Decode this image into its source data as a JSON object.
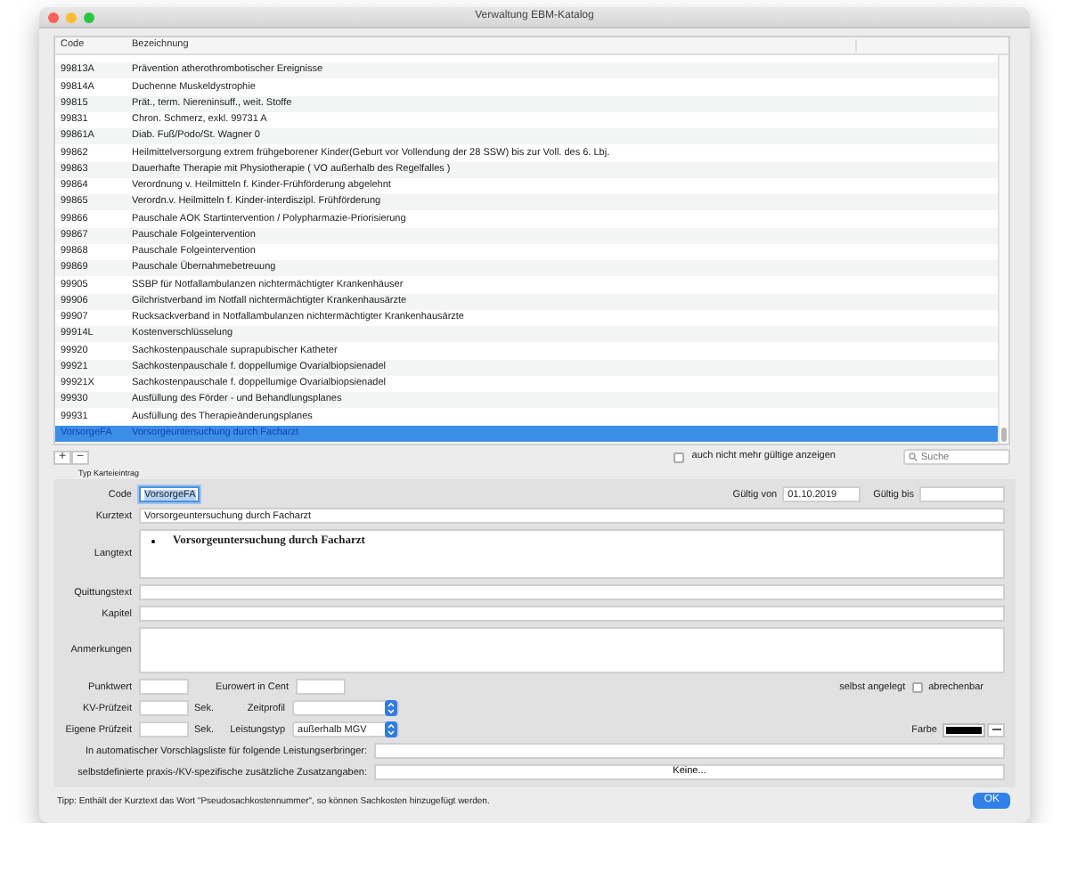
{
  "window": {
    "title": "Verwaltung EBM-Katalog"
  },
  "table": {
    "columns": [
      "Code",
      "Bezeichnung"
    ],
    "rows": [
      {
        "code": "99813A",
        "text": "Prävention atherothrombotischer Ereignisse",
        "selected": false
      },
      {
        "code": "99814A",
        "text": "Duchenne Muskeldystrophie",
        "selected": false
      },
      {
        "code": "99815",
        "text": "Prät., term. Niereninsuff., weit. Stoffe",
        "selected": false
      },
      {
        "code": "99831",
        "text": "Chron. Schmerz, exkl. 99731 A",
        "selected": false
      },
      {
        "code": "99861A",
        "text": "Diab. Fuß/Podo/St. Wagner 0",
        "selected": false
      },
      {
        "code": "99862",
        "text": "Heilmittelversorgung extrem frühgeborener Kinder(Geburt vor Vollendung der 28 SSW) bis zur Voll. des 6. Lbj.",
        "selected": false
      },
      {
        "code": "99863",
        "text": "Dauerhafte Therapie mit Physiotherapie ( VO außerhalb des Regelfalles )",
        "selected": false
      },
      {
        "code": "99864",
        "text": "Verordnung v. Heilmitteln f. Kinder-Frühförderung abgelehnt",
        "selected": false
      },
      {
        "code": "99865",
        "text": "Verordn.v. Heilmitteln f. Kinder-interdiszipl. Frühförderung",
        "selected": false
      },
      {
        "code": "99866",
        "text": "Pauschale AOK Startintervention / Polypharmazie-Priorisierung",
        "selected": false
      },
      {
        "code": "99867",
        "text": "Pauschale Folgeintervention",
        "selected": false
      },
      {
        "code": "99868",
        "text": "Pauschale Folgeintervention",
        "selected": false
      },
      {
        "code": "99869",
        "text": "Pauschale Übernahmebetreuung",
        "selected": false
      },
      {
        "code": "99905",
        "text": "SSBP für Notfallambulanzen nichtermächtigter Krankenhäuser",
        "selected": false
      },
      {
        "code": "99906",
        "text": "Gilchristverband im Notfall nichtermächtigter Krankenhausärzte",
        "selected": false
      },
      {
        "code": "99907",
        "text": "Rucksackverband in Notfallambulanzen nichtermächtigter Krankenhausärzte",
        "selected": false
      },
      {
        "code": "99914L",
        "text": "Kostenverschlüsselung",
        "selected": false
      },
      {
        "code": "99920",
        "text": "Sachkostenpauschale suprapubischer Katheter",
        "selected": false
      },
      {
        "code": "99921",
        "text": "Sachkostenpauschale f. doppellumige Ovarialbiopsienadel",
        "selected": false
      },
      {
        "code": "99921X",
        "text": "Sachkostenpauschale f. doppellumige Ovarialbiopsienadel",
        "selected": false
      },
      {
        "code": "99930",
        "text": "Ausfüllung des Förder - und Behandlungsplanes",
        "selected": false
      },
      {
        "code": "99931",
        "text": "Ausfüllung des Therapieänderungsplanes",
        "selected": false
      },
      {
        "code": "VorsorgeFA",
        "text": "Vorsorgeuntersuchung durch Facharzt",
        "selected": true
      }
    ]
  },
  "list_buttons": [
    "+",
    "−"
  ],
  "show_invalid": {
    "label": "auch nicht mehr gültige anzeigen",
    "checked": false
  },
  "search": {
    "placeholder": "Suche"
  },
  "form": {
    "section_label": "Typ Karteieintrag",
    "code": {
      "label": "Code",
      "value": "VorsorgeFA"
    },
    "valid_from": {
      "label": "Gültig von",
      "value": "01.10.2019"
    },
    "valid_to": {
      "label": "Gültig bis"
    },
    "short_text": {
      "label": "Kurztext",
      "value": "Vorsorgeuntersuchung durch Facharzt"
    },
    "long_text": {
      "label": "Langtext",
      "value": "Vorsorgeuntersuchung durch Facharzt"
    },
    "receipt_text": {
      "label": "Quittungstext"
    },
    "chapter": {
      "label": "Kapitel"
    },
    "notes": {
      "label": "Anmerkungen"
    },
    "point_value": {
      "label": "Punktwert"
    },
    "euro_value": {
      "label": "Eurowert in Cent"
    },
    "self_created": {
      "label": "selbst angelegt"
    },
    "billable": {
      "label": "abrechenbar",
      "checked": false
    },
    "kv_time": {
      "label": "KV-Prüfzeit",
      "unit": "Sek."
    },
    "time_profile": {
      "label": "Zeitprofil"
    },
    "own_time": {
      "label": "Eigene Prüfzeit",
      "unit": "Sek."
    },
    "service_type": {
      "label": "Leistungstyp",
      "value": "außerhalb MGV"
    },
    "color": {
      "label": "Farbe",
      "color": "#000000"
    },
    "auto_list": {
      "label": "In automatischer Vorschlagsliste für folgende Leistungserbringer:"
    },
    "extra": {
      "label": "selbstdefinierte praxis-/KV-spezifische zusätzliche Zusatzangaben:",
      "button": "Keine..."
    }
  },
  "tip": "Tipp: Enthält der Kurztext das Wort \"Pseudosachkostennummer\", so können Sachkosten hinzugefügt werden.",
  "ok_button": "OK"
}
